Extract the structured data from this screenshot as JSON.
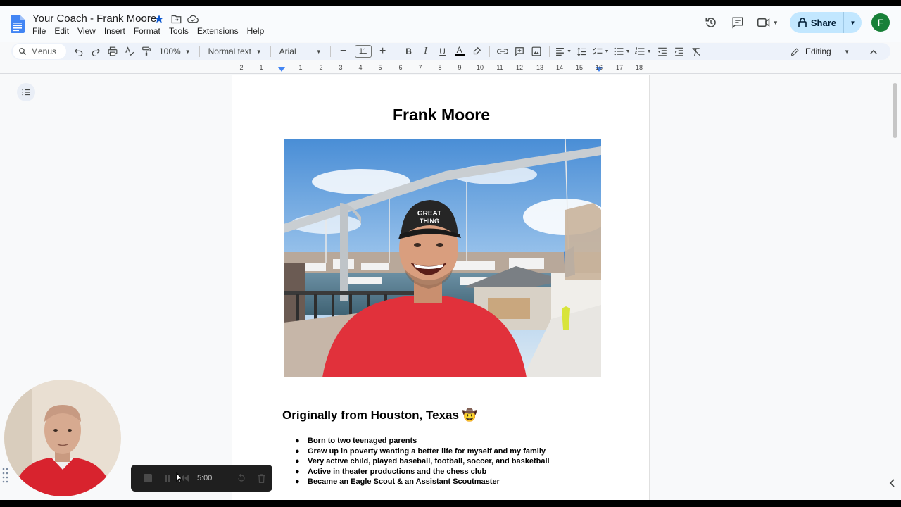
{
  "doc": {
    "title": "Your Coach - Frank Moore",
    "menu": [
      "File",
      "Edit",
      "View",
      "Insert",
      "Format",
      "Tools",
      "Extensions",
      "Help"
    ]
  },
  "header": {
    "share_label": "Share",
    "account_initial": "F"
  },
  "toolbar": {
    "search_label": "Menus",
    "zoom": "100%",
    "style": "Normal text",
    "font": "Arial",
    "font_size": "11",
    "mode": "Editing"
  },
  "ruler": {
    "ticks": [
      "2",
      "1",
      "1",
      "2",
      "3",
      "4",
      "5",
      "6",
      "7",
      "8",
      "9",
      "10",
      "11",
      "12",
      "13",
      "14",
      "15",
      "16",
      "17",
      "18"
    ]
  },
  "content": {
    "heading": "Frank Moore",
    "section_title": "Originally from Houston, Texas 🤠",
    "bullets": [
      "Born to two teenaged parents",
      "Grew up in poverty wanting a better life for myself and my family",
      "Very active child, played baseball, football, soccer, and basketball",
      "Active in theater productions and the chess club",
      "Became an Eagle Scout & an Assistant Scoutmaster"
    ]
  },
  "recorder": {
    "time": "5:00"
  },
  "colors": {
    "share_bg": "#c2e7ff",
    "avatar_bg": "#188038",
    "docs_blue": "#4285f4"
  }
}
